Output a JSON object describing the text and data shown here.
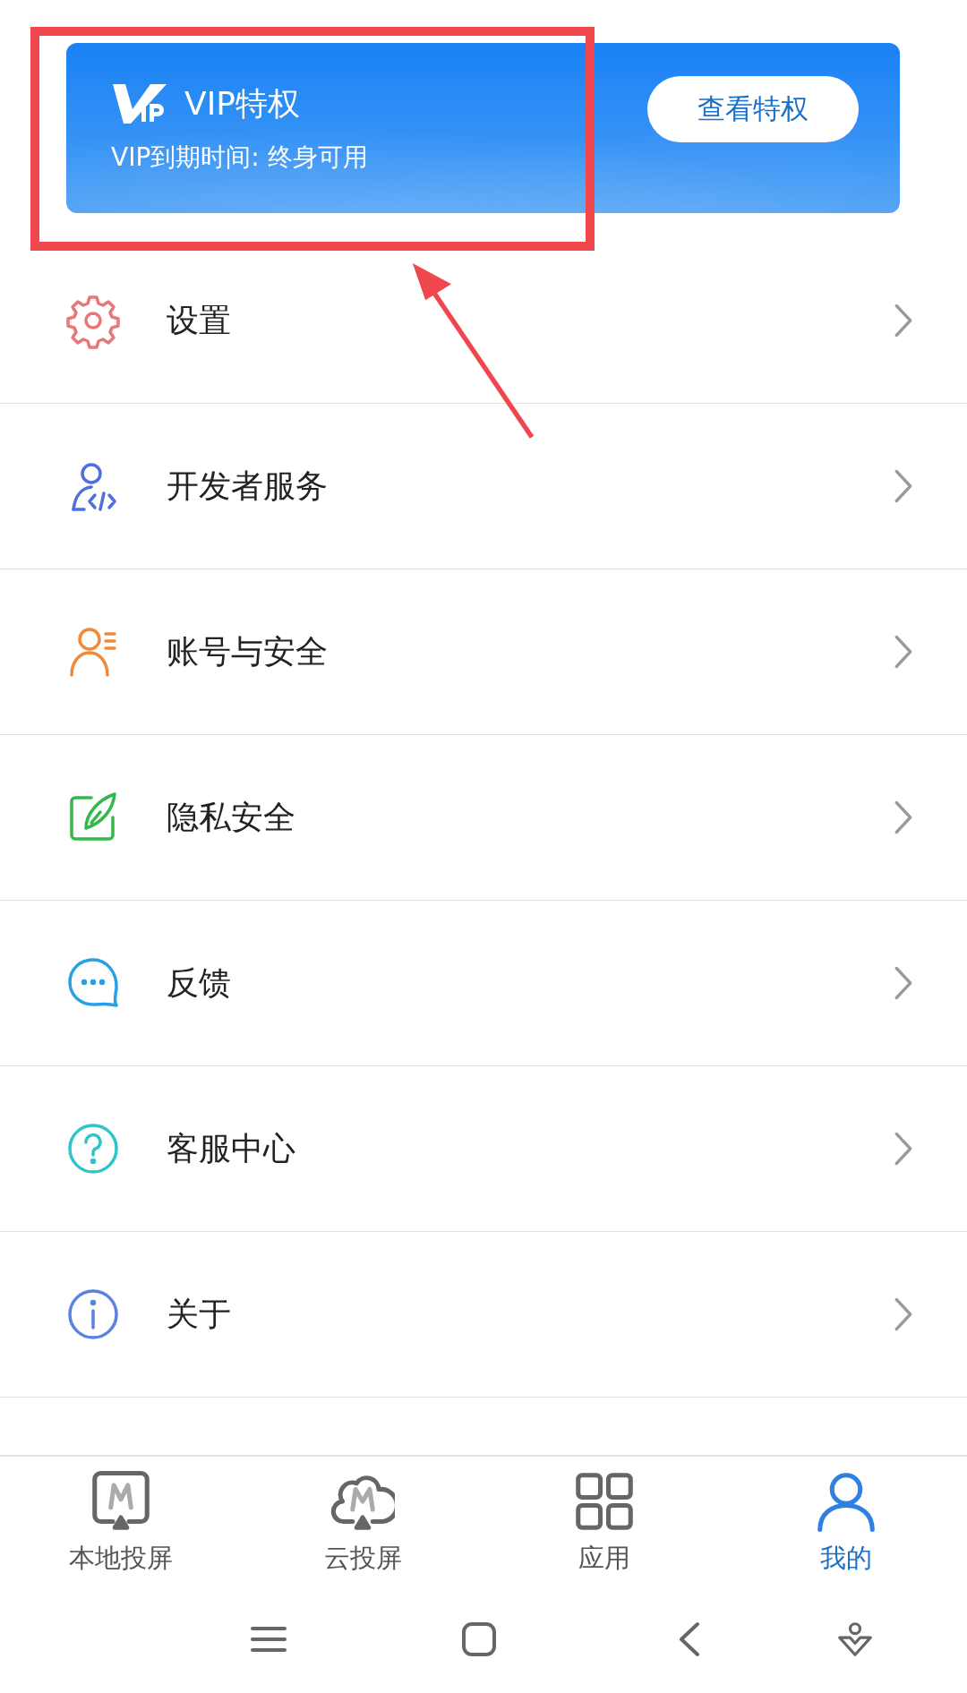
{
  "vip_card": {
    "title": "VIP特权",
    "expiry": "VIP到期时间: 终身可用",
    "button": "查看特权"
  },
  "menu": [
    {
      "kind": "settings",
      "label": "设置"
    },
    {
      "kind": "developer",
      "label": "开发者服务"
    },
    {
      "kind": "account",
      "label": "账号与安全"
    },
    {
      "kind": "privacy",
      "label": "隐私安全"
    },
    {
      "kind": "feedback",
      "label": "反馈"
    },
    {
      "kind": "help",
      "label": "客服中心"
    },
    {
      "kind": "about",
      "label": "关于"
    }
  ],
  "tabs": [
    {
      "kind": "local",
      "label": "本地投屏",
      "selected": false
    },
    {
      "kind": "cloud",
      "label": "云投屏",
      "selected": false
    },
    {
      "kind": "apps",
      "label": "应用",
      "selected": false
    },
    {
      "kind": "me",
      "label": "我的",
      "selected": true
    }
  ]
}
